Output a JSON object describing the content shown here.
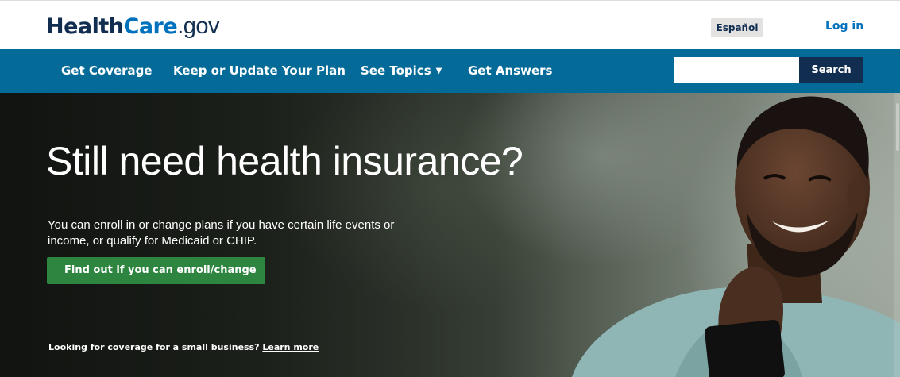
{
  "header": {
    "logo": {
      "health": "Health",
      "care": "Care",
      "gov": ".gov"
    },
    "language_button": "Español",
    "login_link": "Log in"
  },
  "nav": {
    "items": [
      {
        "label": "Get Coverage"
      },
      {
        "label": "Keep or Update Your Plan"
      },
      {
        "label": "See Topics",
        "dropdown_icon": "caret-down-icon"
      },
      {
        "label": "Get Answers"
      }
    ],
    "search": {
      "value": "",
      "placeholder": "",
      "button_label": "Search"
    }
  },
  "hero": {
    "title": "Still need health insurance?",
    "body": "You can enroll in or change plans if you have certain life events or income, or qualify for Medicaid or CHIP.",
    "cta_label": "Find out if you can enroll/change",
    "small_business_text": "Looking for coverage for a small business?",
    "small_business_link": "Learn more"
  },
  "colors": {
    "brand_navy": "#112e51",
    "brand_blue": "#0071bc",
    "nav_bar": "#046b99",
    "cta_green": "#2e8540",
    "language_button_bg": "#e4e2e0"
  }
}
